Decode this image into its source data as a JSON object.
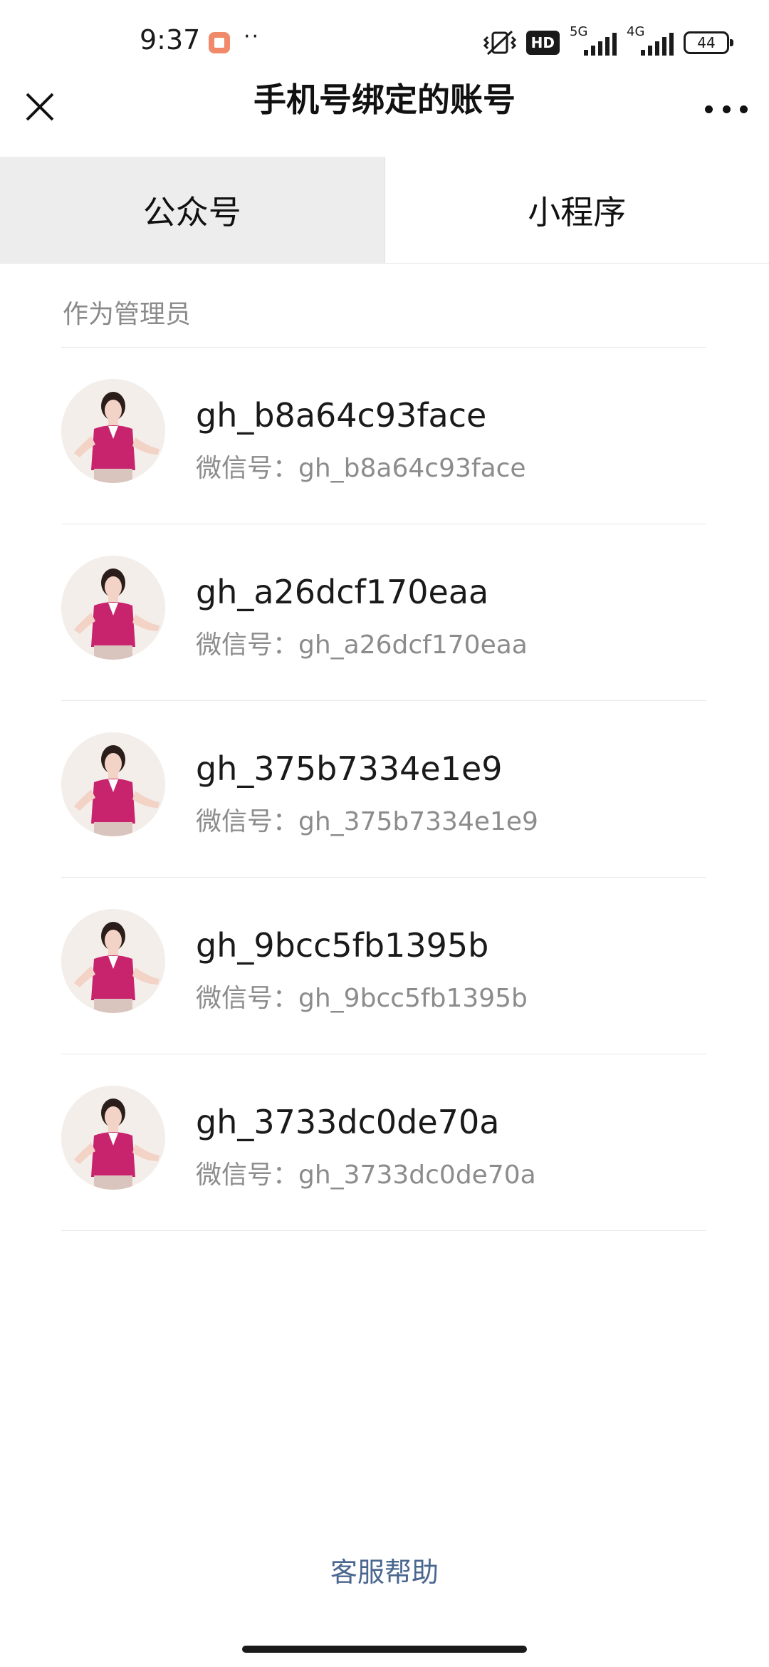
{
  "status_bar": {
    "time": "9:37",
    "dots": "··",
    "hd_label": "HD",
    "net1_label": "5G",
    "net2_label": "4G",
    "battery": "44"
  },
  "header": {
    "title": "手机号绑定的账号"
  },
  "tabs": [
    {
      "label": "公众号",
      "active": true
    },
    {
      "label": "小程序",
      "active": false
    }
  ],
  "section": {
    "title": "作为管理员"
  },
  "accounts": [
    {
      "name": "gh_b8a64c93face",
      "wechat_id": "微信号：gh_b8a64c93face"
    },
    {
      "name": "gh_a26dcf170eaa",
      "wechat_id": "微信号：gh_a26dcf170eaa"
    },
    {
      "name": "gh_375b7334e1e9",
      "wechat_id": "微信号：gh_375b7334e1e9"
    },
    {
      "name": "gh_9bcc5fb1395b",
      "wechat_id": "微信号：gh_9bcc5fb1395b"
    },
    {
      "name": "gh_3733dc0de70a",
      "wechat_id": "微信号：gh_3733dc0de70a"
    }
  ],
  "footer": {
    "help_label": "客服帮助"
  },
  "colors": {
    "link": "#4a6790",
    "active_tab_bg": "#ededed",
    "avatar_vest": "#c8246e"
  }
}
